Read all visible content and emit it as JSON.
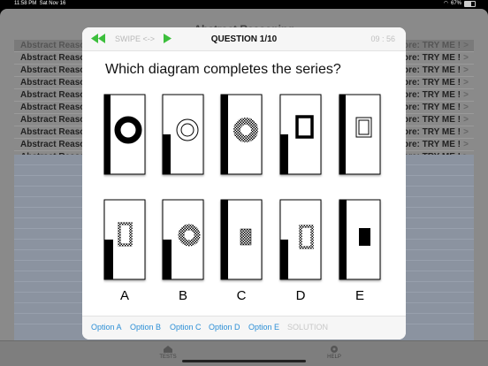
{
  "status": {
    "time": "11:58 PM",
    "date": "Sat Nov 16",
    "battery": "67%"
  },
  "background": {
    "title": "Abstract Reasoning",
    "header_row": {
      "label": "Abstract Reasoning",
      "score": "score: TRY ME !"
    },
    "rows": [
      {
        "label": "Abstract Reasonin",
        "score": "score: TRY ME !"
      },
      {
        "label": "Abstract Reasonin",
        "score": "score: TRY ME !"
      },
      {
        "label": "Abstract Reasonin",
        "score": "score: TRY ME !"
      },
      {
        "label": "Abstract Reasonin",
        "score": "score: TRY ME !"
      },
      {
        "label": "Abstract Reasonin",
        "score": "score: TRY ME !"
      },
      {
        "label": "Abstract Reasonin",
        "score": "score: TRY ME !"
      },
      {
        "label": "Abstract Reasonin",
        "score": "score: TRY ME !"
      },
      {
        "label": "Abstract Reasonin",
        "score": "score: TRY ME !"
      },
      {
        "label": "Abstract Reasonin",
        "score": "score: TRY ME !"
      }
    ],
    "chevron": ">",
    "tabs": {
      "tests": "TESTS",
      "help": "HELP"
    }
  },
  "modal": {
    "swipe_label": "SWIPE <->",
    "question_title": "QUESTION 1/10",
    "timer": "09 : 56",
    "question_text": "Which diagram completes the series?",
    "answer_letters": [
      "A",
      "B",
      "C",
      "D",
      "E"
    ],
    "options": [
      "Option A",
      "Option B",
      "Option C",
      "Option D",
      "Option E"
    ],
    "solution_label": "SOLUTION",
    "colors": {
      "accent_green": "#3cbf3c",
      "link_blue": "#2c8fd6"
    }
  }
}
